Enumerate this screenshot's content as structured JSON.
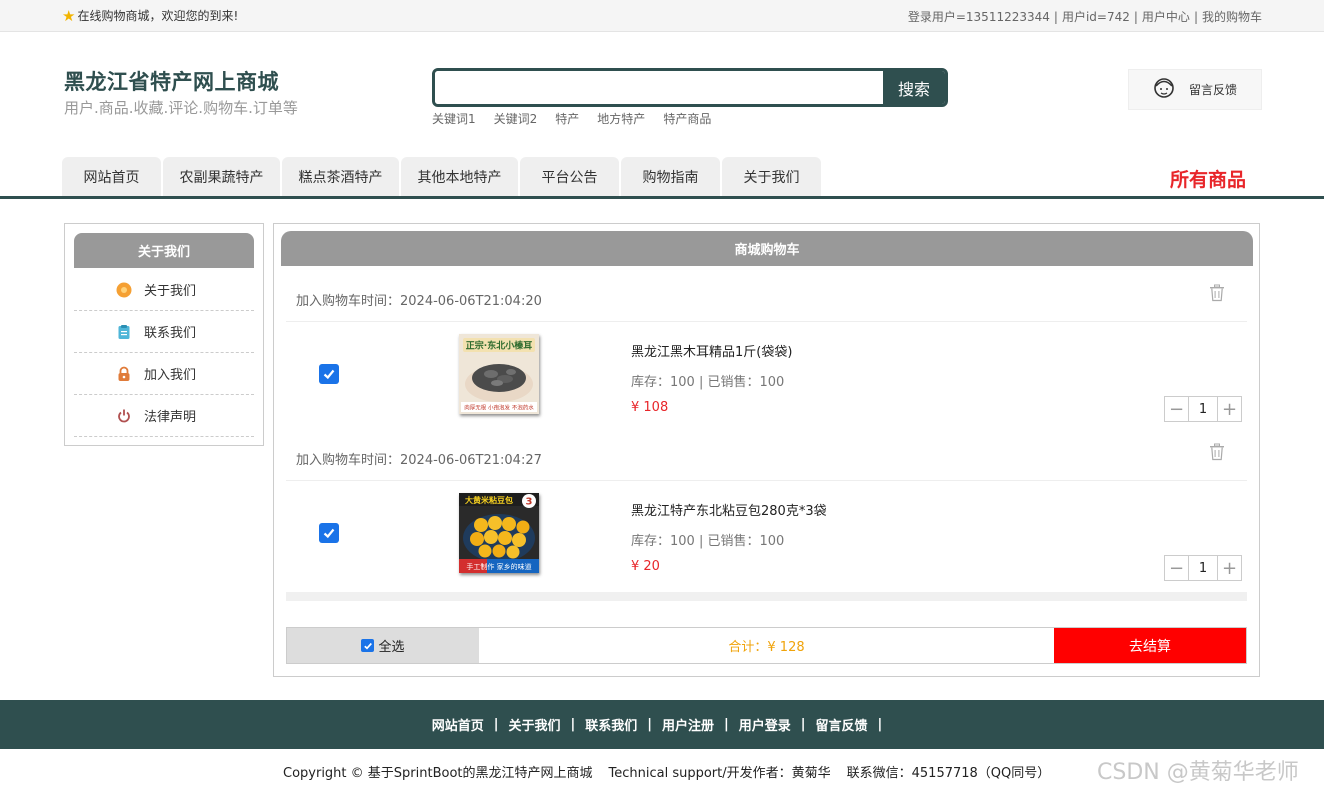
{
  "topbar": {
    "welcome": "在线购物商城，欢迎您的到来!",
    "links": [
      "登录用户=13511223344",
      "用户id=742",
      "用户中心",
      "我的购物车"
    ]
  },
  "header": {
    "title": "黑龙江省特产网上商城",
    "subtitle": "用户.商品.收藏.评论.购物车.订单等",
    "search_button": "搜索",
    "search_value": "",
    "keywords": [
      "关键词1",
      "关键词2",
      "特产",
      "地方特产",
      "特产商品"
    ],
    "feedback": "留言反馈"
  },
  "nav": {
    "tabs": [
      "网站首页",
      "农副果蔬特产",
      "糕点茶酒特产",
      "其他本地特产",
      "平台公告",
      "购物指南",
      "关于我们"
    ],
    "all_goods": "所有商品"
  },
  "sidebar": {
    "title": "关于我们",
    "items": [
      {
        "label": "关于我们",
        "icon": "orange-circle-icon"
      },
      {
        "label": "联系我们",
        "icon": "clipboard-icon"
      },
      {
        "label": "加入我们",
        "icon": "lock-icon"
      },
      {
        "label": "法律声明",
        "icon": "power-icon"
      }
    ]
  },
  "cart": {
    "title": "商城购物车",
    "items": [
      {
        "time": "加入购物车时间：2024-06-06T21:04:20",
        "checked": true,
        "name": "黑龙江黑木耳精品1斤(袋袋)",
        "image_text_top": "正宗·东北小榛耳",
        "image_text_bottom": "肉厚无根 小孢泡发 不泡药水",
        "stock": "库存：100 | 已销售：100",
        "price": "¥ 108",
        "quantity": "1"
      },
      {
        "time": "加入购物车时间：2024-06-06T21:04:27",
        "checked": true,
        "name": "黑龙江特产东北粘豆包280克*3袋",
        "image_text_top": "大黄米粘豆包",
        "image_badge": "3",
        "image_text_bottom": "手工制作 家乡的味道",
        "stock": "库存：100 | 已销售：100",
        "price": "¥ 20",
        "quantity": "1"
      }
    ],
    "select_all": "全选",
    "total": "合计：¥ 128",
    "checkout": "去结算"
  },
  "footer": {
    "links": [
      "网站首页",
      "关于我们",
      "联系我们",
      "用户注册",
      "用户登录",
      "留言反馈"
    ],
    "copyright": "Copyright © 基于SprintBoot的黑龙江特产网上商城",
    "support": "Technical support/开发作者：黄菊华",
    "contact": "联系微信：45157718（QQ同号）"
  },
  "watermark": "CSDN @黄菊华老师",
  "colors": {
    "brand": "#2f4f4f",
    "accent_red": "#e8262a",
    "checkout": "#ff0000",
    "total": "#f0a30a",
    "checkbox": "#1a73e8"
  }
}
